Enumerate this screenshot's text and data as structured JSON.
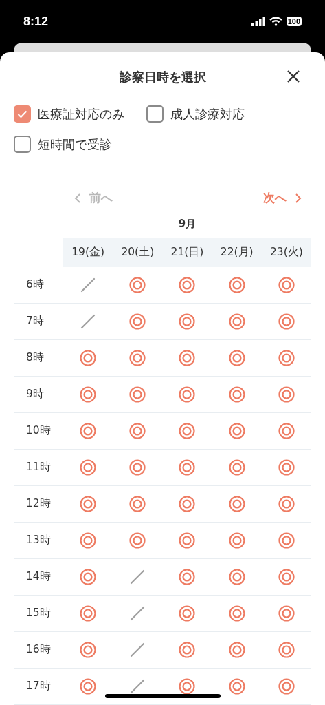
{
  "status_bar": {
    "time": "8:12",
    "battery": "100"
  },
  "sheet": {
    "title": "診察日時を選択"
  },
  "filters": [
    {
      "label": "医療証対応のみ",
      "checked": true
    },
    {
      "label": "成人診療対応",
      "checked": false
    },
    {
      "label": "短時間で受診",
      "checked": false
    }
  ],
  "nav": {
    "prev": {
      "label": "前へ",
      "disabled": true
    },
    "next": {
      "label": "次へ",
      "disabled": false
    }
  },
  "month": "9月",
  "days": [
    "19(金)",
    "20(土)",
    "21(日)",
    "22(月)",
    "23(火)"
  ],
  "rows": [
    {
      "hour": "6時",
      "slots": [
        {
          "available": false
        },
        {
          "available": true
        },
        {
          "available": true
        },
        {
          "available": true
        },
        {
          "available": true
        }
      ]
    },
    {
      "hour": "7時",
      "slots": [
        {
          "available": false
        },
        {
          "available": true
        },
        {
          "available": true
        },
        {
          "available": true
        },
        {
          "available": true
        }
      ]
    },
    {
      "hour": "8時",
      "slots": [
        {
          "available": true
        },
        {
          "available": true
        },
        {
          "available": true
        },
        {
          "available": true
        },
        {
          "available": true
        }
      ]
    },
    {
      "hour": "9時",
      "slots": [
        {
          "available": true
        },
        {
          "available": true
        },
        {
          "available": true
        },
        {
          "available": true
        },
        {
          "available": true
        }
      ]
    },
    {
      "hour": "10時",
      "slots": [
        {
          "available": true
        },
        {
          "available": true
        },
        {
          "available": true
        },
        {
          "available": true
        },
        {
          "available": true
        }
      ]
    },
    {
      "hour": "11時",
      "slots": [
        {
          "available": true
        },
        {
          "available": true
        },
        {
          "available": true
        },
        {
          "available": true
        },
        {
          "available": true
        }
      ]
    },
    {
      "hour": "12時",
      "slots": [
        {
          "available": true
        },
        {
          "available": true
        },
        {
          "available": true
        },
        {
          "available": true
        },
        {
          "available": true
        }
      ]
    },
    {
      "hour": "13時",
      "slots": [
        {
          "available": true
        },
        {
          "available": true
        },
        {
          "available": true
        },
        {
          "available": true
        },
        {
          "available": true
        }
      ]
    },
    {
      "hour": "14時",
      "slots": [
        {
          "available": true
        },
        {
          "available": false
        },
        {
          "available": true
        },
        {
          "available": true
        },
        {
          "available": true
        }
      ]
    },
    {
      "hour": "15時",
      "slots": [
        {
          "available": true
        },
        {
          "available": false
        },
        {
          "available": true
        },
        {
          "available": true
        },
        {
          "available": true
        }
      ]
    },
    {
      "hour": "16時",
      "slots": [
        {
          "available": true
        },
        {
          "available": false
        },
        {
          "available": true
        },
        {
          "available": true
        },
        {
          "available": true
        }
      ]
    },
    {
      "hour": "17時",
      "slots": [
        {
          "available": true
        },
        {
          "available": false
        },
        {
          "available": true
        },
        {
          "available": true
        },
        {
          "available": true
        }
      ]
    }
  ]
}
